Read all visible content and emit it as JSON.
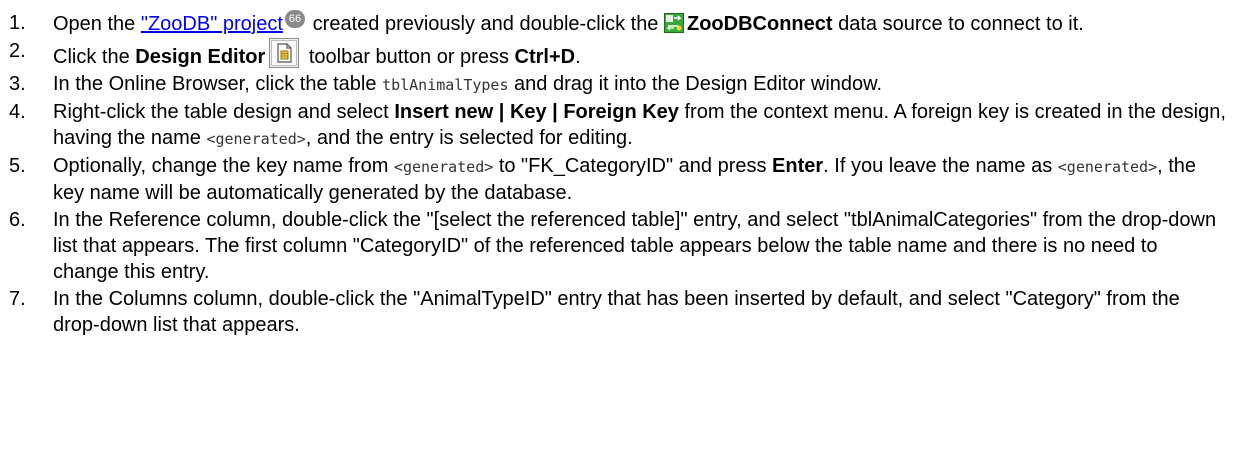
{
  "steps": [
    {
      "num": "1.",
      "t1": "Open the ",
      "link": "\"ZooDB\" project",
      "badge": "66",
      "t2": " created previously and double-click the ",
      "icon": "database-connection-icon",
      "b1": "ZooDBConnect",
      "t3": " data source to connect to it."
    },
    {
      "num": "2.",
      "t1": "Click the ",
      "b1": "Design Editor",
      "icon": "design-editor-icon",
      "t2": " toolbar button or press ",
      "b2": "Ctrl+D",
      "t3": "."
    },
    {
      "num": "3.",
      "t1": "In the Online Browser, click the table ",
      "m1": "tblAnimalTypes",
      "t2": " and drag it into the Design Editor window."
    },
    {
      "num": "4.",
      "t1": "Right-click the table design and select ",
      "b1": "Insert new | Key | Foreign Key",
      "t2": " from the context menu. A foreign key is created in the design, having the name ",
      "m1": "<generated>",
      "t3": ", and the entry is selected for editing."
    },
    {
      "num": "5.",
      "t1": "Optionally, change the key name from ",
      "m1": "<generated>",
      "t2": " to \"FK_CategoryID\" and press ",
      "b1": "Enter",
      "t3": ". If you leave the name as ",
      "m2": "<generated>",
      "t4": ", the key name will be automatically generated by the database."
    },
    {
      "num": "6.",
      "t1": "In the Reference column, double-click the \"[select the referenced table]\" entry, and select \"tblAnimalCategories\" from the drop-down list that appears. The first column \"CategoryID\" of the referenced table appears below the table name and there is no need to change this entry."
    },
    {
      "num": "7.",
      "t1": "In the Columns column, double-click the \"AnimalTypeID\" entry that has been inserted by default, and select \"Category\" from the drop-down list that appears."
    }
  ]
}
